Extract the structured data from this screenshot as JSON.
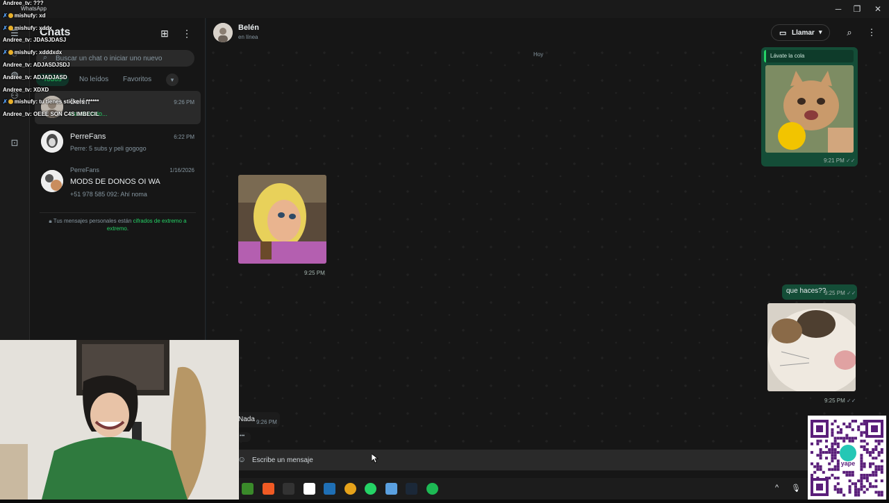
{
  "window": {
    "app_name": "WhatsApp",
    "min_icon": "minimize-icon",
    "max_icon": "restore-icon",
    "close_icon": "close-icon"
  },
  "sidebar": {
    "title": "Chats",
    "new_chat_icon": "new-chat-icon",
    "menu_icon": "kebab-menu-icon",
    "search_placeholder": "Buscar un chat o iniciar uno nuevo",
    "filters": [
      {
        "label": "Todos",
        "active": true
      },
      {
        "label": "No leídos",
        "active": false
      },
      {
        "label": "Favoritos",
        "active": false
      }
    ],
    "filters_more_glyph": "▾",
    "chats": [
      {
        "name": "Belén",
        "preview": "escribiendo...",
        "time": "9:26 PM",
        "selected": true
      },
      {
        "name": "PerreFans",
        "preview": "Perre: 5 subs y peli gogogo",
        "time": "6:22 PM",
        "selected": false
      },
      {
        "group": "PerreFans",
        "name": "MODS DE DONOS OI WA",
        "preview": "+51 978 585 092: Ahí noma",
        "time": "1/16/2026",
        "selected": false
      }
    ],
    "encryption_text": "Tus mensajes personales están",
    "encryption_link": "cifrados de extremo a extremo",
    "encryption_end": "."
  },
  "chat": {
    "contact_name": "Belén",
    "contact_status": "en línea",
    "call_label": "Llamar",
    "day_label": "Hoy",
    "messages": [
      {
        "dir": "out",
        "quote": "Lávate la cola",
        "type": "sticker",
        "time": "9:21 PM",
        "ticks": "✓✓"
      },
      {
        "dir": "in",
        "type": "sticker",
        "time": "9:25 PM"
      },
      {
        "dir": "out",
        "type": "text",
        "text": "que haces??",
        "time": "9:25 PM",
        "ticks": "✓✓"
      },
      {
        "dir": "out",
        "type": "sticker",
        "time": "9:25 PM",
        "ticks": "✓✓"
      },
      {
        "dir": "in",
        "type": "text",
        "text": "Nada",
        "time": "9:26 PM"
      }
    ],
    "typing_dots": "•••",
    "composer_placeholder": "Escribe un mensaje"
  },
  "overlay_chat": [
    {
      "user": "Andree_tv",
      "text": "???",
      "badges": false
    },
    {
      "user": "mishufy",
      "text": "xd",
      "badges": true
    },
    {
      "user": "mishufy",
      "text": "xddx",
      "badges": true
    },
    {
      "user": "Andree_tv",
      "text": "JDASJDASJ",
      "badges": false
    },
    {
      "user": "mishufy",
      "text": "xdddxdx",
      "badges": true
    },
    {
      "user": "Andree_tv",
      "text": "ADJASDJSDJ",
      "badges": false
    },
    {
      "user": "Andree_tv",
      "text": "ADJADJASD",
      "badges": false
    },
    {
      "user": "Andree_tv",
      "text": "XDXD",
      "badges": false
    },
    {
      "user": "mishufy",
      "text": "tu tienes stickers ******",
      "badges": true
    },
    {
      "user": "Andree_tv",
      "text": "OEEE SON C4S IMBECIL",
      "badges": false
    }
  ],
  "taskbar": {
    "apps": [
      "minecraft-icon",
      "brave-icon",
      "epic-games-icon",
      "capcut-icon",
      "calculator-icon",
      "chrome-icon",
      "whatsapp-icon",
      "notepad-icon",
      "steam-icon",
      "spotify-icon"
    ],
    "tray_up": "^",
    "mic_icon": "microphone-icon"
  },
  "qr": {
    "label": "yape"
  },
  "colors": {
    "accent": "#25d366",
    "outgoing_bubble": "#144d37",
    "background": "#161616"
  }
}
